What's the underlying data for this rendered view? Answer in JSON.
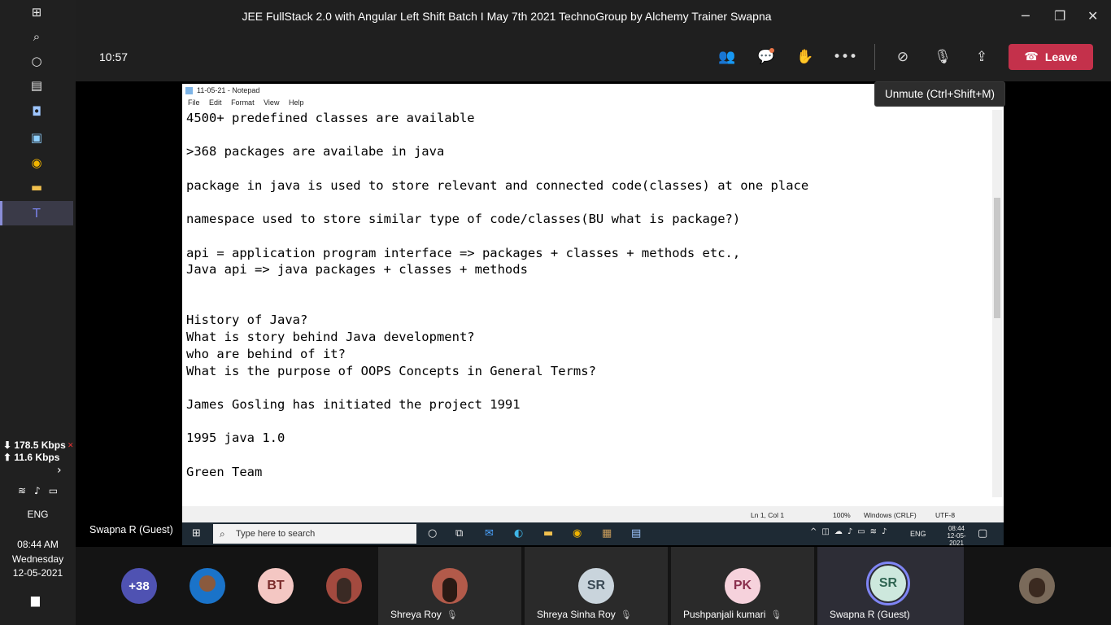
{
  "teams": {
    "window_title": "JEE FullStack 2.0 with Angular Left Shift Batch I May 7th 2021 TechnoGroup by Alchemy Trainer Swapna",
    "timer": "10:57",
    "leave_label": "Leave",
    "tooltip": "Unmute (Ctrl+Shift+M)",
    "presenter": "Swapna R (Guest)",
    "accent_leave": "#c4314b"
  },
  "wintaskbar": {
    "net_down": "178.5 Kbps",
    "net_up": "11.6 Kbps",
    "lang": "ENG",
    "time": "08:44 AM",
    "day": "Wednesday",
    "date": "12-05-2021"
  },
  "notepad": {
    "title": "11-05-21 - Notepad",
    "menu": [
      "File",
      "Edit",
      "Format",
      "View",
      "Help"
    ],
    "lines": [
      "4500+ predefined classes are available",
      "",
      ">368 packages are availabe in java",
      "",
      "package in java is used to store relevant and connected code(classes) at one place",
      "",
      "namespace used to store similar type of code/classes(BU what is package?)",
      "",
      "api = application program interface => packages + classes + methods etc.,",
      "Java api => java packages + classes + methods",
      "",
      "",
      "History of Java?",
      "What is story behind Java development?",
      "who are behind of it?",
      "What is the purpose of OOPS Concepts in General Terms?",
      "",
      "James Gosling has initiated the project 1991",
      "",
      "1995 java 1.0",
      "",
      "Green Team"
    ],
    "status_pos": "Ln 1, Col 1",
    "status_zoom": "100%",
    "status_eol": "Windows (CRLF)",
    "status_enc": "UTF-8"
  },
  "shared_taskbar": {
    "search_placeholder": "Type here to search",
    "lang": "ENG",
    "time": "08:44",
    "date": "12-05-2021"
  },
  "participants": {
    "overflow": "+38",
    "tiles": [
      {
        "initials": "BT",
        "color": "#f4c7c3",
        "text_color": "#7a2b2b"
      },
      {
        "name": "Shreya Roy"
      },
      {
        "initials": "SR",
        "name": "Shreya Sinha Roy",
        "color": "#c9d4dc",
        "text_color": "#3b4a56"
      },
      {
        "initials": "PK",
        "name": "Pushpanjali kumari",
        "color": "#f6d2dc",
        "text_color": "#8a2f4d"
      },
      {
        "initials": "SR",
        "name": "Swapna R (Guest)",
        "color": "#cde8dd",
        "text_color": "#2f6552"
      }
    ]
  }
}
